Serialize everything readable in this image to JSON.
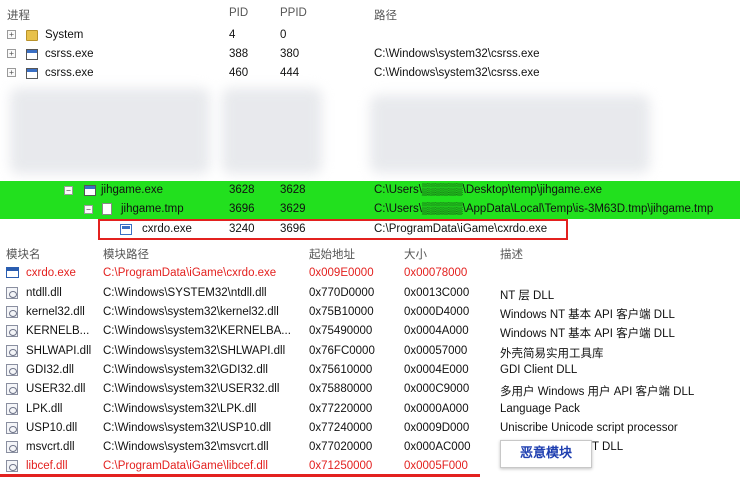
{
  "process_columns": {
    "name": "进程",
    "pid": "PID",
    "ppid": "PPID",
    "path": "路径"
  },
  "processes": [
    {
      "name": "System",
      "pid": "4",
      "ppid": "0",
      "path": "",
      "icon": "folder-icon"
    },
    {
      "name": "csrss.exe",
      "pid": "388",
      "ppid": "380",
      "path": "C:\\Windows\\system32\\csrss.exe",
      "icon": "exe-icon"
    },
    {
      "name": "csrss.exe",
      "pid": "460",
      "ppid": "444",
      "path": "C:\\Windows\\system32\\csrss.exe",
      "icon": "exe-icon"
    },
    {
      "name": "jihgame.exe",
      "pid": "3628",
      "ppid": "3628",
      "path": "C:\\Users\\▒▒▒▒▒\\Desktop\\temp\\jihgame.exe",
      "icon": "exe-icon"
    },
    {
      "name": "jihgame.tmp",
      "pid": "3696",
      "ppid": "3629",
      "path": "C:\\Users\\▒▒▒▒▒\\AppData\\Local\\Temp\\is-3M63D.tmp\\jihgame.tmp",
      "icon": "doc-icon"
    },
    {
      "name": "cxrdo.exe",
      "pid": "3240",
      "ppid": "3696",
      "path": "C:\\ProgramData\\iGame\\cxrdo.exe",
      "icon": "app-icon"
    }
  ],
  "module_columns": {
    "name": "模块名",
    "path": "模块路径",
    "base": "起始地址",
    "size": "大小",
    "desc": "描述"
  },
  "modules": [
    {
      "name": "cxrdo.exe",
      "path": "C:\\ProgramData\\iGame\\cxrdo.exe",
      "base": "0x009E0000",
      "size": "0x00078000",
      "desc": ""
    },
    {
      "name": "ntdll.dll",
      "path": "C:\\Windows\\SYSTEM32\\ntdll.dll",
      "base": "0x770D0000",
      "size": "0x0013C000",
      "desc": "NT 层 DLL"
    },
    {
      "name": "kernel32.dll",
      "path": "C:\\Windows\\system32\\kernel32.dll",
      "base": "0x75B10000",
      "size": "0x000D4000",
      "desc": "Windows NT 基本 API 客户端 DLL"
    },
    {
      "name": "KERNELB...",
      "path": "C:\\Windows\\system32\\KERNELBA...",
      "base": "0x75490000",
      "size": "0x0004A000",
      "desc": "Windows NT 基本 API 客户端 DLL"
    },
    {
      "name": "SHLWAPI.dll",
      "path": "C:\\Windows\\system32\\SHLWAPI.dll",
      "base": "0x76FC0000",
      "size": "0x00057000",
      "desc": "外壳简易实用工具库"
    },
    {
      "name": "GDI32.dll",
      "path": "C:\\Windows\\system32\\GDI32.dll",
      "base": "0x75610000",
      "size": "0x0004E000",
      "desc": "GDI Client DLL"
    },
    {
      "name": "USER32.dll",
      "path": "C:\\Windows\\system32\\USER32.dll",
      "base": "0x75880000",
      "size": "0x000C9000",
      "desc": "多用户 Windows 用户 API 客户端 DLL"
    },
    {
      "name": "LPK.dll",
      "path": "C:\\Windows\\system32\\LPK.dll",
      "base": "0x77220000",
      "size": "0x0000A000",
      "desc": "Language Pack"
    },
    {
      "name": "USP10.dll",
      "path": "C:\\Windows\\system32\\USP10.dll",
      "base": "0x77240000",
      "size": "0x0009D000",
      "desc": "Uniscribe Unicode script processor"
    },
    {
      "name": "msvcrt.dll",
      "path": "C:\\Windows\\system32\\msvcrt.dll",
      "base": "0x77020000",
      "size": "0x000AC000",
      "desc": "T DLL"
    },
    {
      "name": "libcef.dll",
      "path": "C:\\ProgramData\\iGame\\libcef.dll",
      "base": "0x71250000",
      "size": "0x0005F000",
      "desc": ""
    }
  ],
  "annotation": {
    "badge_label": "恶意模块"
  },
  "colors": {
    "highlight_green": "#22e01e",
    "malicious_red": "#e3211f",
    "badge_text": "#1f3fb0"
  }
}
